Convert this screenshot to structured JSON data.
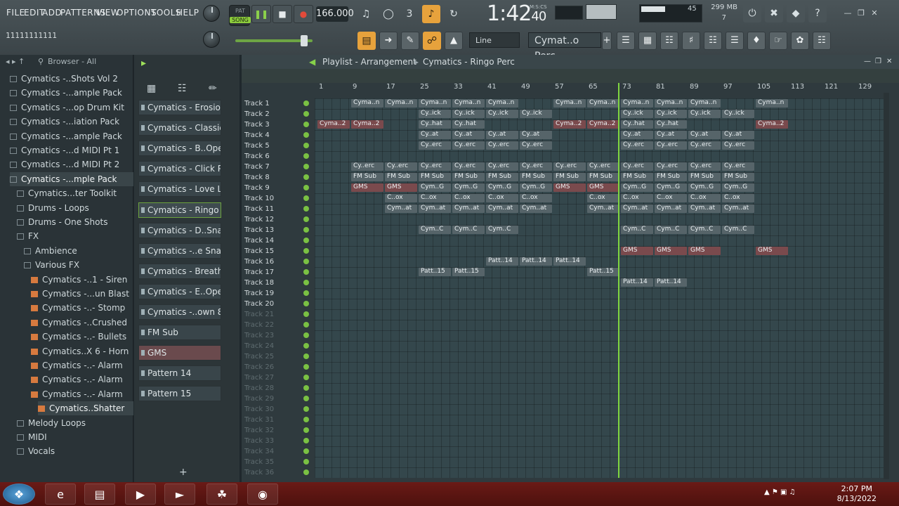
{
  "menu": [
    "FILE",
    "EDIT",
    "ADD",
    "PATTERNS",
    "VIEW",
    "OPTIONS",
    "TOOLS",
    "HELP"
  ],
  "hint_text": "11111111111",
  "transport": {
    "pat": "PAT",
    "song": "SONG",
    "tempo": "166.000",
    "time": "1:42",
    "time_sub": "40",
    "time_label": "M:S:CS"
  },
  "monitor": {
    "cpu": "45",
    "mem": "299 MB",
    "voices": "7"
  },
  "toolbar2": {
    "snap": "Line",
    "channel_selector": "Cymat..o Perc"
  },
  "browser": {
    "title": "Browser - All",
    "items": [
      {
        "label": "Cymatics -..Shots Vol 2",
        "type": "folder",
        "indent": 1
      },
      {
        "label": "Cymatics -...ample Pack",
        "type": "folder",
        "indent": 1
      },
      {
        "label": "Cymatics -...op Drum Kit",
        "type": "folder",
        "indent": 1
      },
      {
        "label": "Cymatics -...iation Pack",
        "type": "folder",
        "indent": 1
      },
      {
        "label": "Cymatics -...ample Pack",
        "type": "folder",
        "indent": 1
      },
      {
        "label": "Cymatics -...d MIDI Pt 1",
        "type": "folder",
        "indent": 1
      },
      {
        "label": "Cymatics -...d MIDI Pt 2",
        "type": "folder",
        "indent": 1
      },
      {
        "label": "Cymatics -...mple Pack",
        "type": "folder",
        "indent": 1,
        "active": true
      },
      {
        "label": "Cymatics...ter Toolkit",
        "type": "folder",
        "indent": 2
      },
      {
        "label": "Drums - Loops",
        "type": "folder",
        "indent": 2
      },
      {
        "label": "Drums - One Shots",
        "type": "folder",
        "indent": 2
      },
      {
        "label": "FX",
        "type": "folder",
        "indent": 2
      },
      {
        "label": "Ambience",
        "type": "folder",
        "indent": 3
      },
      {
        "label": "Various FX",
        "type": "folder",
        "indent": 3
      },
      {
        "label": "Cymatics -..1 - Siren",
        "type": "file",
        "indent": 4
      },
      {
        "label": "Cymatics -...un Blast",
        "type": "file",
        "indent": 4
      },
      {
        "label": "Cymatics -..- Stomp",
        "type": "file",
        "indent": 4
      },
      {
        "label": "Cymatics -..Crushed",
        "type": "file",
        "indent": 4
      },
      {
        "label": "Cymatics -..- Bullets",
        "type": "file",
        "indent": 4
      },
      {
        "label": "Cymatics..X 6 - Horn",
        "type": "file",
        "indent": 4
      },
      {
        "label": "Cymatics -..- Alarm",
        "type": "file",
        "indent": 4
      },
      {
        "label": "Cymatics -..- Alarm",
        "type": "file",
        "indent": 4
      },
      {
        "label": "Cymatics -..- Alarm",
        "type": "file",
        "indent": 4
      },
      {
        "label": "Cymatics..Shatter",
        "type": "file",
        "indent": 5,
        "active": true
      },
      {
        "label": "Melody Loops",
        "type": "folder",
        "indent": 2
      },
      {
        "label": "MIDI",
        "type": "folder",
        "indent": 2
      },
      {
        "label": "Vocals",
        "type": "folder",
        "indent": 2
      }
    ]
  },
  "channels": [
    {
      "label": "Cymatics - Erosion Kick"
    },
    {
      "label": "Cymatics - Classic Hihat"
    },
    {
      "label": "Cymatics - B..Open Hihat"
    },
    {
      "label": "Cymatics - Click Perc"
    },
    {
      "label": "Cymatics - Love Life Perc"
    },
    {
      "label": "Cymatics - Ringo Perc",
      "selected": true
    },
    {
      "label": "Cymatics - D..Snare 2 - F"
    },
    {
      "label": "Cymatics -..e Snare - G"
    },
    {
      "label": "Cymatics - Breath Vox"
    },
    {
      "label": "Cymatics - E..Open Hihat"
    },
    {
      "label": "Cymatics -..own 808 - C"
    },
    {
      "label": "FM Sub"
    },
    {
      "label": "GMS",
      "red": true
    },
    {
      "label": "Pattern 14"
    },
    {
      "label": "Pattern 15"
    }
  ],
  "playlist": {
    "title": "Playlist - Arrangement",
    "crumb": "Cymatics - Ringo Perc",
    "ruler": [
      "1",
      "9",
      "17",
      "25",
      "33",
      "41",
      "49",
      "57",
      "65",
      "73",
      "81",
      "89",
      "97",
      "105",
      "113",
      "121",
      "129"
    ],
    "tracks": [
      "Track 1",
      "Track 2",
      "Track 3",
      "Track 4",
      "Track 5",
      "Track 6",
      "Track 7",
      "Track 8",
      "Track 9",
      "Track 10",
      "Track 11",
      "Track 12",
      "Track 13",
      "Track 14",
      "Track 15",
      "Track 16",
      "Track 17",
      "Track 18",
      "Track 19",
      "Track 20",
      "Track 21",
      "Track 22",
      "Track 23",
      "Track 24",
      "Track 25",
      "Track 26",
      "Track 27",
      "Track 28",
      "Track 29",
      "Track 30",
      "Track 31",
      "Track 32",
      "Track 33",
      "Track 34",
      "Track 35",
      "Track 36"
    ],
    "clips": [
      {
        "t": 0,
        "bars": [
          9,
          17,
          25,
          33,
          41,
          57,
          65,
          73,
          81,
          89,
          105
        ],
        "label": "Cyma..n"
      },
      {
        "t": 1,
        "bars": [
          25,
          33,
          41,
          49,
          73,
          81,
          89,
          97
        ],
        "label": "Cy..ick"
      },
      {
        "t": 2,
        "bars": [
          1,
          9,
          57,
          65,
          105
        ],
        "label": "Cyma..2",
        "style": "red"
      },
      {
        "t": 2,
        "bars": [
          25,
          33,
          73,
          81
        ],
        "label": "Cy..hat"
      },
      {
        "t": 3,
        "bars": [
          25,
          33,
          41,
          49,
          73,
          81,
          89,
          97
        ],
        "label": "Cy..at"
      },
      {
        "t": 4,
        "bars": [
          25,
          33,
          41,
          49,
          73,
          81,
          89,
          97
        ],
        "label": "Cy..erc"
      },
      {
        "t": 6,
        "bars": [
          9,
          17,
          25,
          33,
          41,
          49,
          57,
          65,
          73,
          81,
          89,
          97
        ],
        "label": "Cy..erc"
      },
      {
        "t": 7,
        "bars": [
          9,
          17,
          25,
          33,
          41,
          49,
          57,
          65,
          73,
          81,
          89,
          97
        ],
        "label": "FM Sub"
      },
      {
        "t": 8,
        "bars": [
          9,
          17,
          57,
          65
        ],
        "label": "GMS",
        "style": "red"
      },
      {
        "t": 8,
        "bars": [
          25,
          33,
          41,
          49,
          73,
          81,
          89,
          97
        ],
        "label": "Cym..G"
      },
      {
        "t": 9,
        "bars": [
          17,
          25,
          33,
          41,
          49,
          65,
          73,
          81,
          89,
          97
        ],
        "label": "C..ox"
      },
      {
        "t": 10,
        "bars": [
          17,
          25,
          33,
          41,
          49,
          65,
          73,
          81,
          89,
          97
        ],
        "label": "Cym..at"
      },
      {
        "t": 12,
        "bars": [
          25,
          33,
          41,
          73,
          81,
          89,
          97
        ],
        "label": "Cym..C"
      },
      {
        "t": 14,
        "bars": [
          73,
          81,
          89,
          105
        ],
        "label": "GMS",
        "style": "red"
      },
      {
        "t": 15,
        "bars": [
          41,
          49,
          57
        ],
        "label": "Patt..14"
      },
      {
        "t": 16,
        "bars": [
          25,
          33,
          65
        ],
        "label": "Patt..15"
      },
      {
        "t": 17,
        "bars": [
          73,
          81
        ],
        "label": "Patt..14"
      }
    ]
  },
  "taskbar": {
    "time": "2:07 PM",
    "date": "8/13/2022"
  }
}
